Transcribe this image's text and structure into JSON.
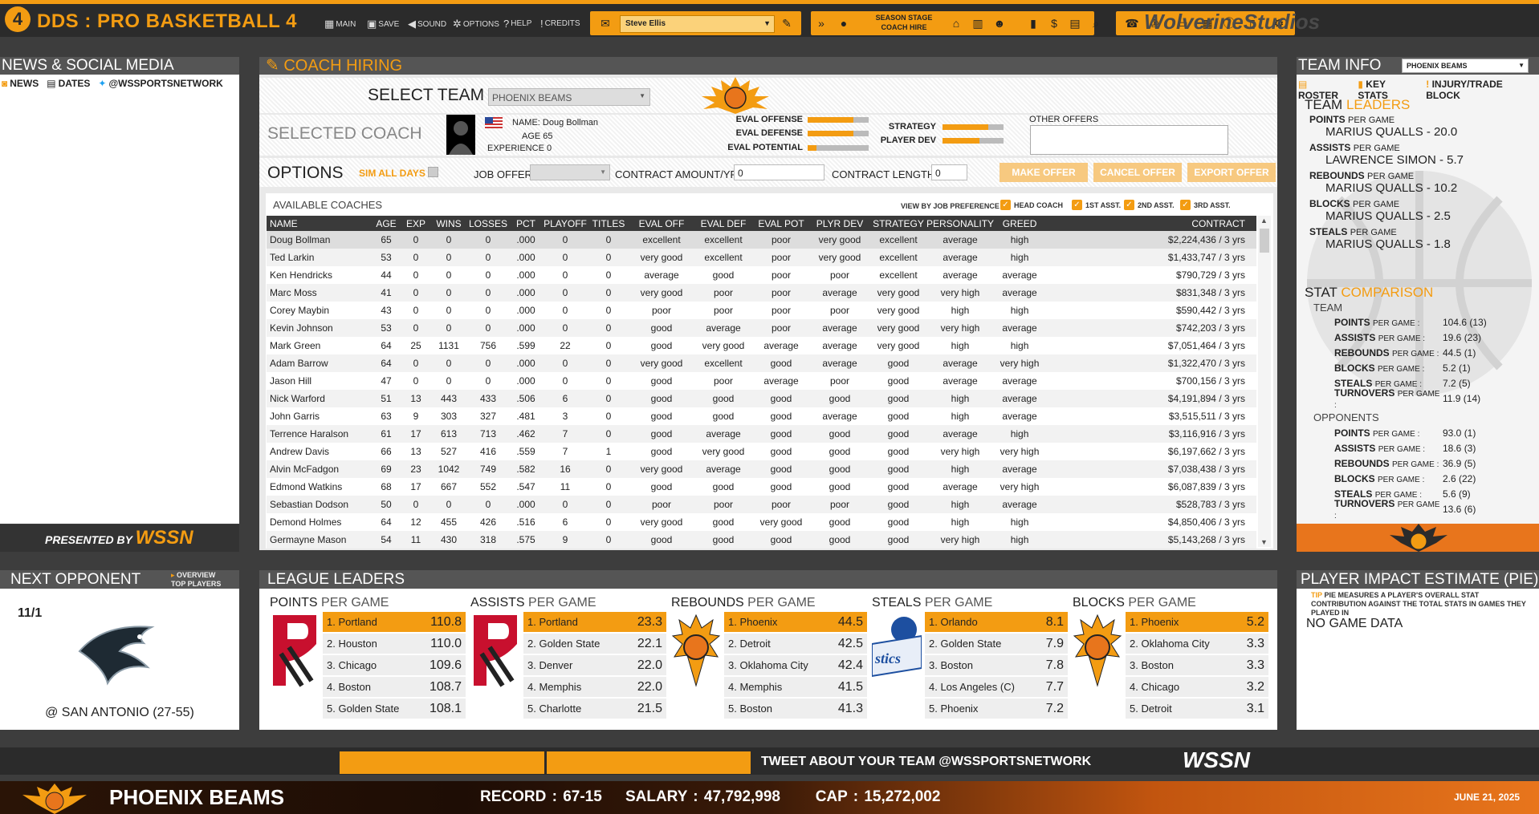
{
  "app": {
    "logo_text": "4",
    "title": "DDS : PRO BASKETBALL 4",
    "studio": "WolverineStudios"
  },
  "menu": {
    "main": "MAIN",
    "save": "SAVE",
    "sound": "SOUND",
    "options": "OPTIONS",
    "help": "HELP",
    "credits": "CREDITS"
  },
  "coach_select": {
    "value": "Steve Ellis"
  },
  "season": {
    "label": "SEASON STAGE",
    "stage": "COACH HIRE"
  },
  "news": {
    "title": "NEWS & SOCIAL MEDIA",
    "tabs": [
      "NEWS",
      "DATES",
      "@WSSPORTSNETWORK"
    ],
    "presented_by": "PRESENTED BY",
    "brand": "WSSN"
  },
  "coach_hiring": {
    "title": "COACH HIRING",
    "select_team_label": "SELECT TEAM",
    "team_value": "PHOENIX BEAMS",
    "selected_coach_label": "SELECTED COACH",
    "coach": {
      "name_label": "NAME",
      "name": "Doug Bollman",
      "age_label": "AGE",
      "age": "65",
      "exp_label": "EXPERIENCE",
      "exp": "0"
    },
    "evals": [
      {
        "label": "EVAL OFFENSE",
        "level": 0.75
      },
      {
        "label": "EVAL DEFENSE",
        "level": 0.75
      },
      {
        "label": "EVAL POTENTIAL",
        "level": 0.15
      }
    ],
    "evals2": [
      {
        "label": "STRATEGY",
        "level": 0.75
      },
      {
        "label": "PLAYER DEV",
        "level": 0.6
      }
    ],
    "other_offers_label": "OTHER OFFERS",
    "options_label": "OPTIONS",
    "sim_all_days": "SIM ALL DAYS",
    "job_offer_label": "JOB OFFER",
    "contract_amount_label": "CONTRACT AMOUNT/YR",
    "contract_amount": "0",
    "contract_length_label": "CONTRACT LENGTH",
    "contract_length": "0",
    "make_offer": "MAKE OFFER",
    "cancel_offer": "CANCEL OFFER",
    "export_offer": "EXPORT OFFER",
    "available_label": "AVAILABLE COACHES",
    "view_by_label": "VIEW BY JOB PREFERENCE",
    "prefs": [
      "HEAD COACH",
      "1ST ASST.",
      "2ND ASST.",
      "3RD ASST."
    ],
    "columns": [
      "NAME",
      "AGE",
      "EXP",
      "WINS",
      "LOSSES",
      "PCT",
      "PLAYOFF",
      "TITLES",
      "EVAL OFF",
      "EVAL DEF",
      "EVAL POT",
      "PLYR DEV",
      "STRATEGY",
      "PERSONALITY",
      "GREED",
      "CONTRACT"
    ],
    "rows": [
      [
        "Doug Bollman",
        "65",
        "0",
        "0",
        "0",
        ".000",
        "0",
        "0",
        "excellent",
        "excellent",
        "poor",
        "very good",
        "excellent",
        "average",
        "high",
        "$2,224,436 / 3 yrs"
      ],
      [
        "Ted Larkin",
        "53",
        "0",
        "0",
        "0",
        ".000",
        "0",
        "0",
        "very good",
        "excellent",
        "poor",
        "very good",
        "excellent",
        "average",
        "high",
        "$1,433,747 / 3 yrs"
      ],
      [
        "Ken Hendricks",
        "44",
        "0",
        "0",
        "0",
        ".000",
        "0",
        "0",
        "average",
        "good",
        "poor",
        "poor",
        "excellent",
        "average",
        "average",
        "$790,729 / 3 yrs"
      ],
      [
        "Marc Moss",
        "41",
        "0",
        "0",
        "0",
        ".000",
        "0",
        "0",
        "very good",
        "poor",
        "poor",
        "average",
        "very good",
        "very high",
        "average",
        "$831,348 / 3 yrs"
      ],
      [
        "Corey Maybin",
        "43",
        "0",
        "0",
        "0",
        ".000",
        "0",
        "0",
        "poor",
        "poor",
        "poor",
        "poor",
        "very good",
        "high",
        "high",
        "$590,442 / 3 yrs"
      ],
      [
        "Kevin Johnson",
        "53",
        "0",
        "0",
        "0",
        ".000",
        "0",
        "0",
        "good",
        "average",
        "poor",
        "average",
        "very good",
        "very high",
        "average",
        "$742,203 / 3 yrs"
      ],
      [
        "Mark Green",
        "64",
        "25",
        "1131",
        "756",
        ".599",
        "22",
        "0",
        "good",
        "very good",
        "average",
        "average",
        "very good",
        "high",
        "high",
        "$7,051,464 / 3 yrs"
      ],
      [
        "Adam Barrow",
        "64",
        "0",
        "0",
        "0",
        ".000",
        "0",
        "0",
        "very good",
        "excellent",
        "good",
        "average",
        "good",
        "average",
        "very high",
        "$1,322,470 / 3 yrs"
      ],
      [
        "Jason Hill",
        "47",
        "0",
        "0",
        "0",
        ".000",
        "0",
        "0",
        "good",
        "poor",
        "average",
        "poor",
        "good",
        "average",
        "average",
        "$700,156 / 3 yrs"
      ],
      [
        "Nick Warford",
        "51",
        "13",
        "443",
        "433",
        ".506",
        "6",
        "0",
        "good",
        "good",
        "good",
        "good",
        "good",
        "high",
        "average",
        "$4,191,894 / 3 yrs"
      ],
      [
        "John Garris",
        "63",
        "9",
        "303",
        "327",
        ".481",
        "3",
        "0",
        "good",
        "good",
        "good",
        "average",
        "good",
        "high",
        "average",
        "$3,515,511 / 3 yrs"
      ],
      [
        "Terrence Haralson",
        "61",
        "17",
        "613",
        "713",
        ".462",
        "7",
        "0",
        "good",
        "average",
        "good",
        "good",
        "good",
        "average",
        "high",
        "$3,116,916 / 3 yrs"
      ],
      [
        "Andrew Davis",
        "66",
        "13",
        "527",
        "416",
        ".559",
        "7",
        "1",
        "good",
        "very good",
        "good",
        "good",
        "good",
        "very high",
        "very high",
        "$6,197,662 / 3 yrs"
      ],
      [
        "Alvin McFadgon",
        "69",
        "23",
        "1042",
        "749",
        ".582",
        "16",
        "0",
        "very good",
        "average",
        "good",
        "good",
        "good",
        "high",
        "average",
        "$7,038,438 / 3 yrs"
      ],
      [
        "Edmond Watkins",
        "68",
        "17",
        "667",
        "552",
        ".547",
        "11",
        "0",
        "good",
        "good",
        "good",
        "good",
        "good",
        "average",
        "very high",
        "$6,087,839 / 3 yrs"
      ],
      [
        "Sebastian Dodson",
        "50",
        "0",
        "0",
        "0",
        ".000",
        "0",
        "0",
        "poor",
        "poor",
        "poor",
        "poor",
        "good",
        "high",
        "average",
        "$528,783 / 3 yrs"
      ],
      [
        "Demond Holmes",
        "64",
        "12",
        "455",
        "426",
        ".516",
        "6",
        "0",
        "very good",
        "good",
        "very good",
        "good",
        "good",
        "high",
        "high",
        "$4,850,406 / 3 yrs"
      ],
      [
        "Germayne Mason",
        "54",
        "11",
        "430",
        "318",
        ".575",
        "9",
        "0",
        "good",
        "good",
        "good",
        "good",
        "good",
        "very high",
        "high",
        "$5,143,268 / 3 yrs"
      ]
    ]
  },
  "team_info": {
    "title": "TEAM INFO",
    "team_value": "PHOENIX BEAMS",
    "tabs": [
      "ROSTER",
      "KEY STATS",
      "INJURY/TRADE BLOCK"
    ],
    "leaders_title": "TEAM",
    "leaders_title2": "LEADERS",
    "leaders": [
      {
        "cat": "POINTS",
        "per": "PER GAME",
        "value": "MARIUS QUALLS - 20.0"
      },
      {
        "cat": "ASSISTS",
        "per": "PER GAME",
        "value": "LAWRENCE SIMON - 5.7"
      },
      {
        "cat": "REBOUNDS",
        "per": "PER GAME",
        "value": "MARIUS QUALLS - 10.2"
      },
      {
        "cat": "BLOCKS",
        "per": "PER GAME",
        "value": "MARIUS QUALLS - 2.5"
      },
      {
        "cat": "STEALS",
        "per": "PER GAME",
        "value": "MARIUS QUALLS - 1.8"
      }
    ],
    "comparison_title": "STAT",
    "comparison_title2": "COMPARISON",
    "team_label": "TEAM",
    "team_stats": [
      {
        "cat": "POINTS",
        "per": "PER GAME :",
        "value": "104.6 (13)"
      },
      {
        "cat": "ASSISTS",
        "per": "PER GAME :",
        "value": "19.6 (23)"
      },
      {
        "cat": "REBOUNDS",
        "per": "PER GAME :",
        "value": "44.5 (1)"
      },
      {
        "cat": "BLOCKS",
        "per": "PER GAME :",
        "value": "5.2 (1)"
      },
      {
        "cat": "STEALS",
        "per": "PER GAME :",
        "value": "7.2 (5)"
      },
      {
        "cat": "TURNOVERS",
        "per": "PER GAME :",
        "value": "11.9 (14)"
      }
    ],
    "opp_label": "OPPONENTS",
    "opp_stats": [
      {
        "cat": "POINTS",
        "per": "PER GAME :",
        "value": "93.0 (1)"
      },
      {
        "cat": "ASSISTS",
        "per": "PER GAME :",
        "value": "18.6 (3)"
      },
      {
        "cat": "REBOUNDS",
        "per": "PER GAME :",
        "value": "36.9 (5)"
      },
      {
        "cat": "BLOCKS",
        "per": "PER GAME :",
        "value": "2.6 (22)"
      },
      {
        "cat": "STEALS",
        "per": "PER GAME :",
        "value": "5.6 (9)"
      },
      {
        "cat": "TURNOVERS",
        "per": "PER GAME :",
        "value": "13.6 (6)"
      }
    ]
  },
  "next_opponent": {
    "title": "NEXT OPPONENT",
    "link1": "OVERVIEW",
    "link2": "TOP PLAYERS",
    "date": "11/1",
    "opponent": "@ SAN ANTONIO (27-55)"
  },
  "league_leaders": {
    "title": "LEAGUE LEADERS",
    "cats": [
      {
        "cat": "POINTS",
        "per": "PER GAME",
        "logo": "portland-logo",
        "rows": [
          [
            "1. Portland",
            "110.8"
          ],
          [
            "2. Houston",
            "110.0"
          ],
          [
            "3. Chicago",
            "109.6"
          ],
          [
            "4. Boston",
            "108.7"
          ],
          [
            "5. Golden State",
            "108.1"
          ]
        ]
      },
      {
        "cat": "ASSISTS",
        "per": "PER GAME",
        "logo": "portland-logo",
        "rows": [
          [
            "1. Portland",
            "23.3"
          ],
          [
            "2. Golden State",
            "22.1"
          ],
          [
            "3. Denver",
            "22.0"
          ],
          [
            "4. Memphis",
            "22.0"
          ],
          [
            "5. Charlotte",
            "21.5"
          ]
        ]
      },
      {
        "cat": "REBOUNDS",
        "per": "PER GAME",
        "logo": "phoenix-logo",
        "rows": [
          [
            "1. Phoenix",
            "44.5"
          ],
          [
            "2. Detroit",
            "42.5"
          ],
          [
            "3. Oklahoma City",
            "42.4"
          ],
          [
            "4. Memphis",
            "41.5"
          ],
          [
            "5. Boston",
            "41.3"
          ]
        ]
      },
      {
        "cat": "STEALS",
        "per": "PER GAME",
        "logo": "orlando-logo",
        "rows": [
          [
            "1. Orlando",
            "8.1"
          ],
          [
            "2. Golden State",
            "7.9"
          ],
          [
            "3. Boston",
            "7.8"
          ],
          [
            "4. Los Angeles (C)",
            "7.7"
          ],
          [
            "5. Phoenix",
            "7.2"
          ]
        ]
      },
      {
        "cat": "BLOCKS",
        "per": "PER GAME",
        "logo": "phoenix-logo",
        "rows": [
          [
            "1. Phoenix",
            "5.2"
          ],
          [
            "2. Oklahoma City",
            "3.3"
          ],
          [
            "3. Boston",
            "3.3"
          ],
          [
            "4. Chicago",
            "3.2"
          ],
          [
            "5. Detroit",
            "3.1"
          ]
        ]
      }
    ]
  },
  "pie": {
    "title": "PLAYER IMPACT ESTIMATE (PIE)",
    "tip_label": "TIP",
    "tip": "PIE MEASURES A PLAYER'S OVERALL STAT CONTRIBUTION AGAINST THE TOTAL STATS IN GAMES THEY PLAYED IN",
    "nodata": "NO GAME DATA"
  },
  "ticker": {
    "tweet": "TWEET ABOUT YOUR TEAM @WSSPORTSNETWORK",
    "brand": "WSSN"
  },
  "bottom": {
    "team": "PHOENIX BEAMS",
    "record": "RECORD : 67-15",
    "salary": "SALARY : 47,792,998",
    "cap": "CAP : 15,272,002",
    "date": "JUNE 21, 2025"
  },
  "colors": {
    "accent": "#f39c12",
    "header": "#555555",
    "dark": "#2b2b2b"
  }
}
